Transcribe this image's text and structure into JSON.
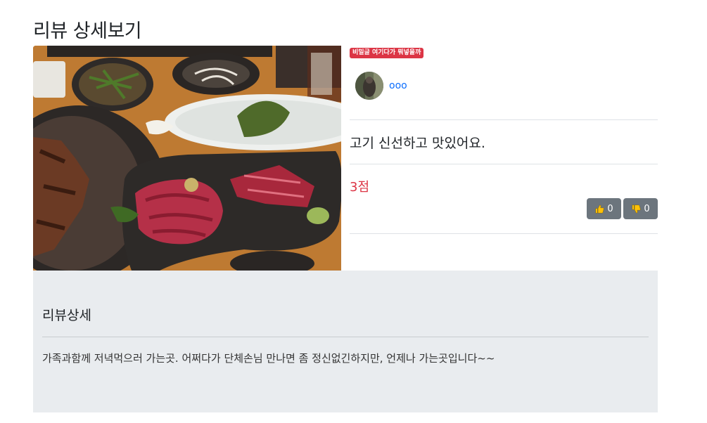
{
  "page": {
    "title": "리뷰 상세보기"
  },
  "review": {
    "secret_badge": "비밀글 여기다가 뭐넣을까",
    "author": "ooo",
    "short_text": "고기 신선하고 맛있어요.",
    "score": "3점",
    "likes": "0",
    "dislikes": "0"
  },
  "detail": {
    "title": "리뷰상세",
    "body": "가족과함께 저녁먹으러 가는곳. 어쩌다가 단체손님 만나면 좀 정신없긴하지만, 언제나 가는곳입니다~~"
  },
  "icons": {
    "like": "thumbs-up-icon",
    "dislike": "thumbs-down-icon"
  },
  "colors": {
    "badge": "#dc3545",
    "score": "#dc3545",
    "link": "#0d6efd",
    "button": "#6c757d",
    "section_bg": "#e9ecef"
  }
}
